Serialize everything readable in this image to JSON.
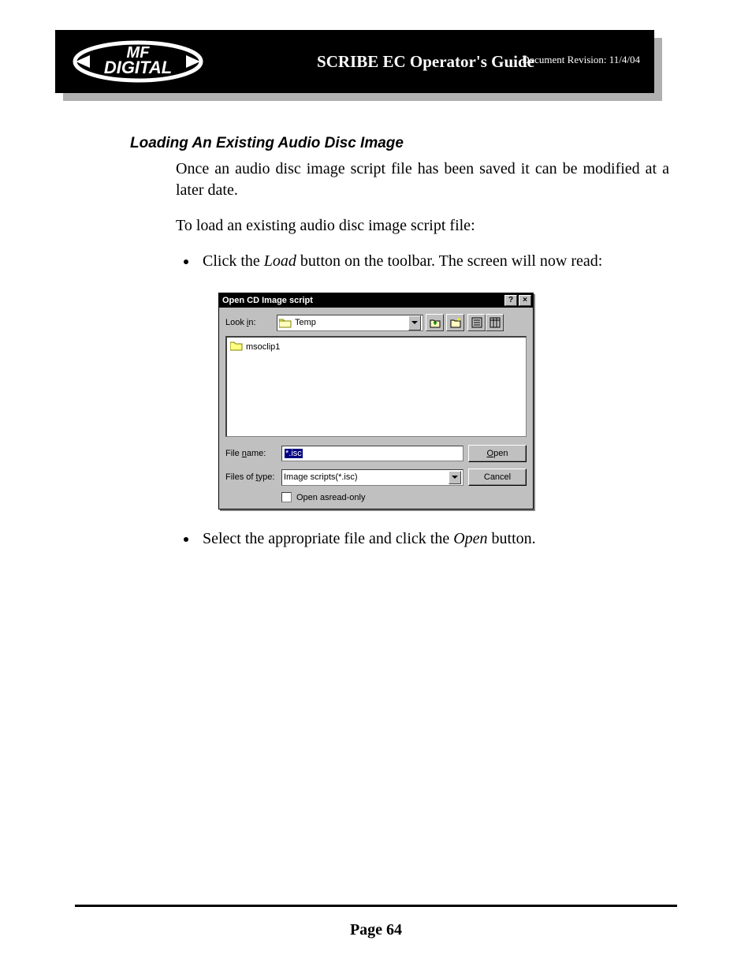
{
  "header": {
    "title": "SCRIBE EC Operator's Guide",
    "revision": "Document Revision: 11/4/04",
    "logo_top": "MF",
    "logo_bottom": "DIGITAL"
  },
  "section": {
    "title": "Loading An Existing Audio Disc Image",
    "para1": "Once an audio disc image script file has been saved it can be modified at a later date.",
    "para2": "To load an existing audio disc image script file:",
    "bullet1_pre": "Click the ",
    "bullet1_em": "Load",
    "bullet1_post": " button on the toolbar. The screen will now read:",
    "bullet2_pre": "Select the appropriate file and click the ",
    "bullet2_em": "Open",
    "bullet2_post": " button."
  },
  "dialog": {
    "title": "Open CD Image script",
    "help_btn": "?",
    "close_btn": "×",
    "lookin_label_pre": "Look ",
    "lookin_label_u": "i",
    "lookin_label_post": "n:",
    "lookin_value": "Temp",
    "file_item": "msoclip1",
    "filename_label_pre": "File ",
    "filename_label_u": "n",
    "filename_label_post": "ame:",
    "filename_value": "*.isc",
    "filetype_label_pre": "Files of ",
    "filetype_label_u": "t",
    "filetype_label_post": "ype:",
    "filetype_value": "Image scripts(*.isc)",
    "readonly_label_pre": "Open as ",
    "readonly_label_u": "r",
    "readonly_label_post": "ead-only",
    "open_btn_u": "O",
    "open_btn_post": "pen",
    "cancel_btn": "Cancel"
  },
  "footer": {
    "page": "Page 64"
  }
}
